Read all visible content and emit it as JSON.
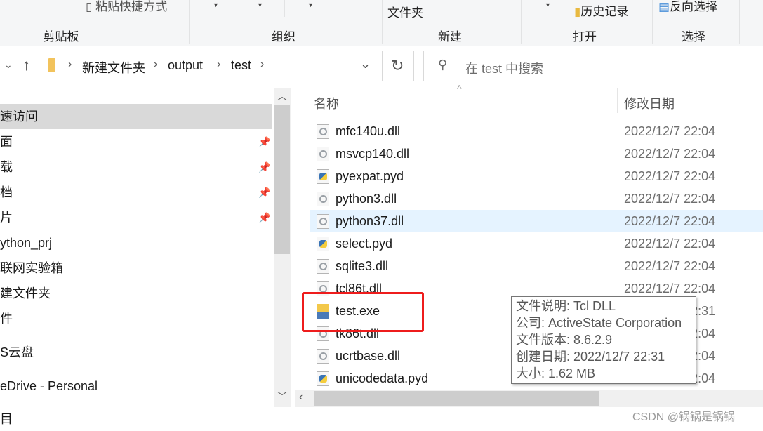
{
  "ribbon": {
    "paste_shortcut": "粘贴快捷方式",
    "new_folder": "文件夹",
    "history": "历史记录",
    "invert_select": "反向选择",
    "groups": [
      "剪贴板",
      "组织",
      "新建",
      "打开",
      "选择"
    ]
  },
  "nav": {
    "up": "↑",
    "back_caret": "⌄",
    "breadcrumb": [
      "新建文件夹",
      "output",
      "test"
    ],
    "refresh": "↻",
    "dropdown": "⌄"
  },
  "search": {
    "placeholder": "在 test 中搜索"
  },
  "sidebar": {
    "items": [
      {
        "label": "速访问",
        "selected": true
      },
      {
        "label": "面",
        "pinned": true
      },
      {
        "label": "载",
        "pinned": true
      },
      {
        "label": "档",
        "pinned": true
      },
      {
        "label": "片",
        "pinned": true
      },
      {
        "label": "ython_prj"
      },
      {
        "label": "联网实验箱"
      },
      {
        "label": "建文件夹"
      },
      {
        "label": "件"
      },
      {
        "label": "S云盘"
      },
      {
        "label": "eDrive - Personal"
      },
      {
        "label": "目"
      }
    ]
  },
  "columns": {
    "name": "名称",
    "date": "修改日期"
  },
  "files": [
    {
      "name": "mfc140u.dll",
      "date": "2022/12/7 22:04",
      "type": "dll"
    },
    {
      "name": "msvcp140.dll",
      "date": "2022/12/7 22:04",
      "type": "dll"
    },
    {
      "name": "pyexpat.pyd",
      "date": "2022/12/7 22:04",
      "type": "pyd"
    },
    {
      "name": "python3.dll",
      "date": "2022/12/7 22:04",
      "type": "dll"
    },
    {
      "name": "python37.dll",
      "date": "2022/12/7 22:04",
      "type": "dll",
      "hover": true
    },
    {
      "name": "select.pyd",
      "date": "2022/12/7 22:04",
      "type": "pyd"
    },
    {
      "name": "sqlite3.dll",
      "date": "2022/12/7 22:04",
      "type": "dll"
    },
    {
      "name": "tcl86t.dll",
      "date": "2022/12/7 22:04",
      "type": "dll"
    },
    {
      "name": "test.exe",
      "date": "2022/12/7 22:31",
      "type": "exe"
    },
    {
      "name": "tk86t.dll",
      "date": "2022/12/7 22:04",
      "type": "dll"
    },
    {
      "name": "ucrtbase.dll",
      "date": "2022/12/7 22:04",
      "type": "dll"
    },
    {
      "name": "unicodedata.pyd",
      "date": "2022/12/7 22:04",
      "type": "pyd"
    }
  ],
  "tooltip": [
    "文件说明: Tcl DLL",
    "公司: ActiveState Corporation",
    "文件版本: 8.6.2.9",
    "创建日期: 2022/12/7 22:31",
    "大小: 1.62 MB"
  ],
  "watermark": "CSDN @锅锅是锅锅",
  "colors": {
    "highlight": "#e5f3ff",
    "selected": "#d9d9d9",
    "redbox": "#ee1c1c"
  }
}
